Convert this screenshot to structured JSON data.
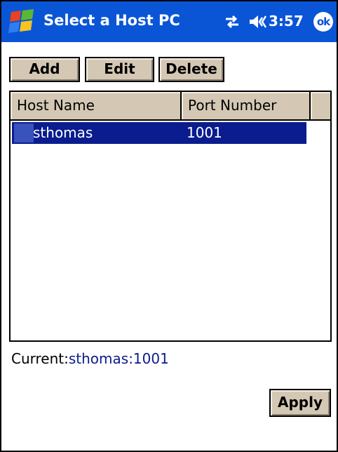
{
  "window": {
    "title": "Select a Host PC",
    "time": "3:57",
    "ok_label": "ok"
  },
  "toolbar": {
    "add_label": "Add",
    "edit_label": "Edit",
    "delete_label": "Delete"
  },
  "hosts_list": {
    "columns": [
      "Host Name",
      "Port Number"
    ],
    "rows": [
      {
        "host": "sthomas",
        "port": "1001",
        "selected": true
      }
    ]
  },
  "current": {
    "label": "Current:",
    "value": "sthomas:1001"
  },
  "apply_label": "Apply",
  "colors": {
    "title_bar": "#0a55d6",
    "selection": "#0a1c8e",
    "button_face": "#d4c8b4"
  },
  "icons": {
    "start": "windows-flag-icon",
    "connectivity": "connectivity-arrows-icon",
    "volume": "speaker-icon",
    "row": "host-computer-icon"
  }
}
